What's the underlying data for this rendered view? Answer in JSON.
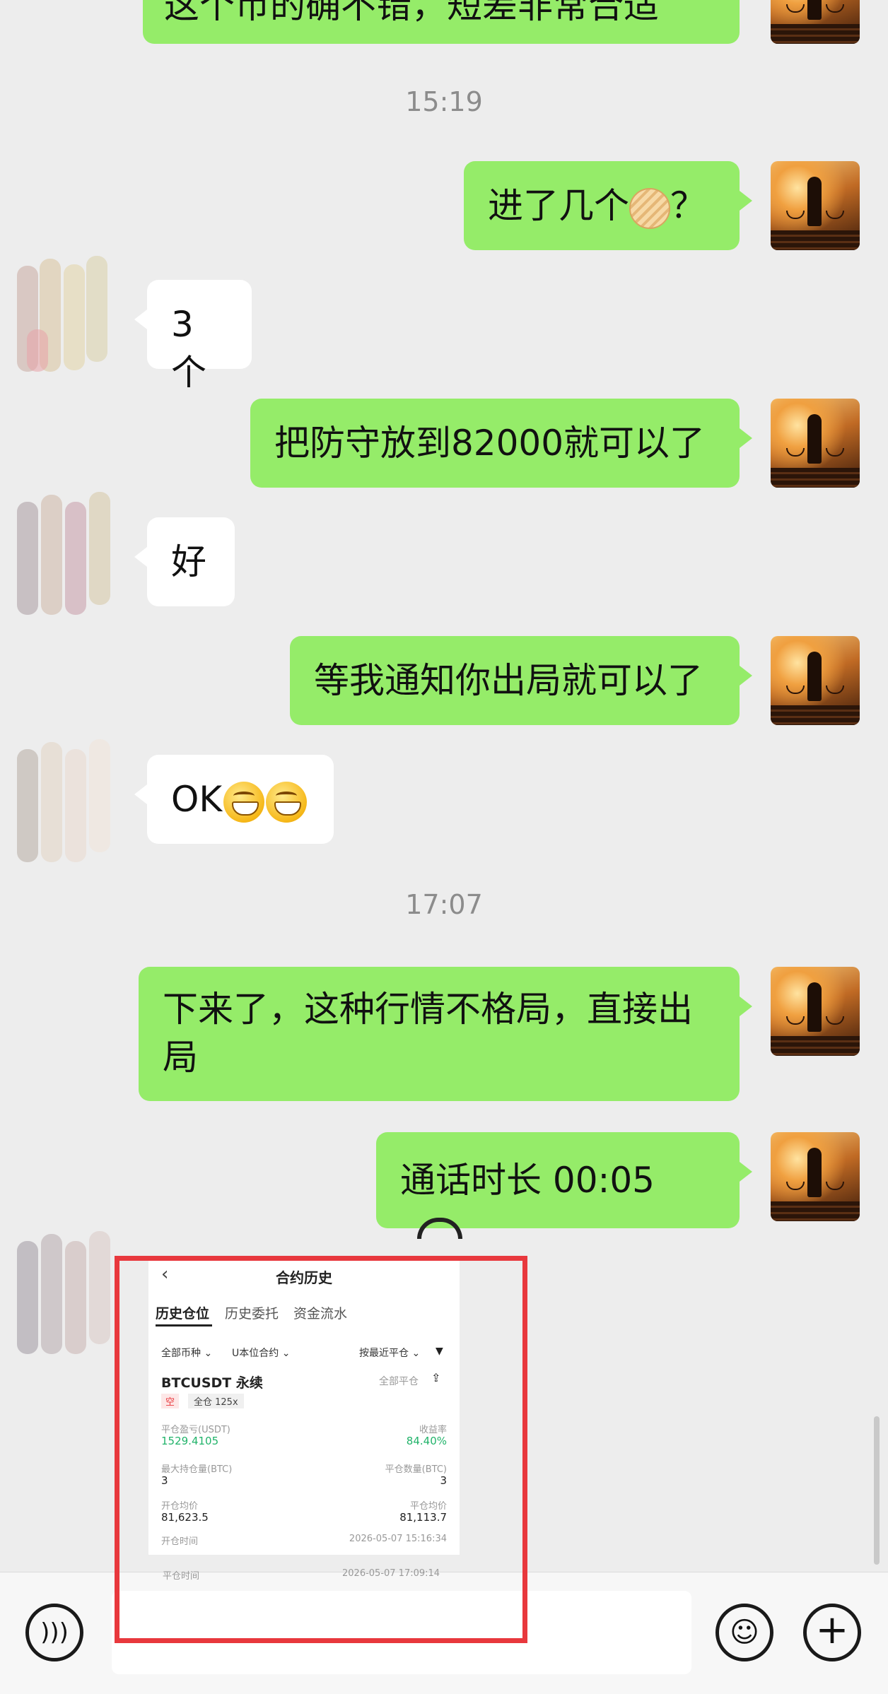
{
  "chat": {
    "messages": [
      {
        "from": "me",
        "text": "这个币的确不错，短差非常合适"
      },
      {
        "type": "time",
        "text": "15:19"
      },
      {
        "from": "me",
        "text": "进了几个",
        "emoji": "cookie-emoji",
        "suffix": "？"
      },
      {
        "from": "them",
        "text": "3个"
      },
      {
        "from": "me",
        "text": "把防守放到82000就可以了"
      },
      {
        "from": "them",
        "text": "好"
      },
      {
        "from": "me",
        "text": "等我通知你出局就可以了"
      },
      {
        "from": "them",
        "text": "OK",
        "emoji": "grinning-emoji"
      },
      {
        "type": "time",
        "text": "17:07"
      },
      {
        "from": "me",
        "text_line1": "下来了，这种行情不格局，直接出",
        "text_line2": "局"
      },
      {
        "from": "me",
        "text": "通话时长 00:05",
        "icon": "phone-hangup-icon"
      }
    ]
  },
  "shot": {
    "title": "合约历史",
    "tabs": [
      "历史仓位",
      "历史委托",
      "资金流水"
    ],
    "filters": {
      "coin": "全部币种",
      "contract": "U本位合约",
      "sort": "按最近平仓"
    },
    "pair": "BTCUSDT 永续",
    "close_all": "全部平仓",
    "side": "空",
    "margin": "全仓 125x",
    "pnl_label": "平仓盈亏(USDT)",
    "pnl_value": "1529.4105",
    "roi_label": "收益率",
    "roi_value": "84.40%",
    "max_pos_label": "最大持仓量(BTC)",
    "max_pos_value": "3",
    "close_qty_label": "平仓数量(BTC)",
    "close_qty_value": "3",
    "open_avg_label": "开仓均价",
    "open_avg_value": "81,623.5",
    "close_avg_label": "平仓均价",
    "close_avg_value": "81,113.7",
    "open_time_label": "开仓时间",
    "open_time_value": "2026-05-07 15:16:34",
    "close_time_label": "平仓时间",
    "close_time_value": "2026-05-07 17:09:14"
  },
  "input": {
    "voice_icon": "voice-icon",
    "emoji_icon": "emoji-icon",
    "plus_icon": "plus-icon"
  },
  "colors": {
    "bubble_mine": "#95ec69",
    "bubble_theirs": "#ffffff",
    "background": "#ededed",
    "highlight": "#e8383d",
    "profit": "#21b36a"
  }
}
